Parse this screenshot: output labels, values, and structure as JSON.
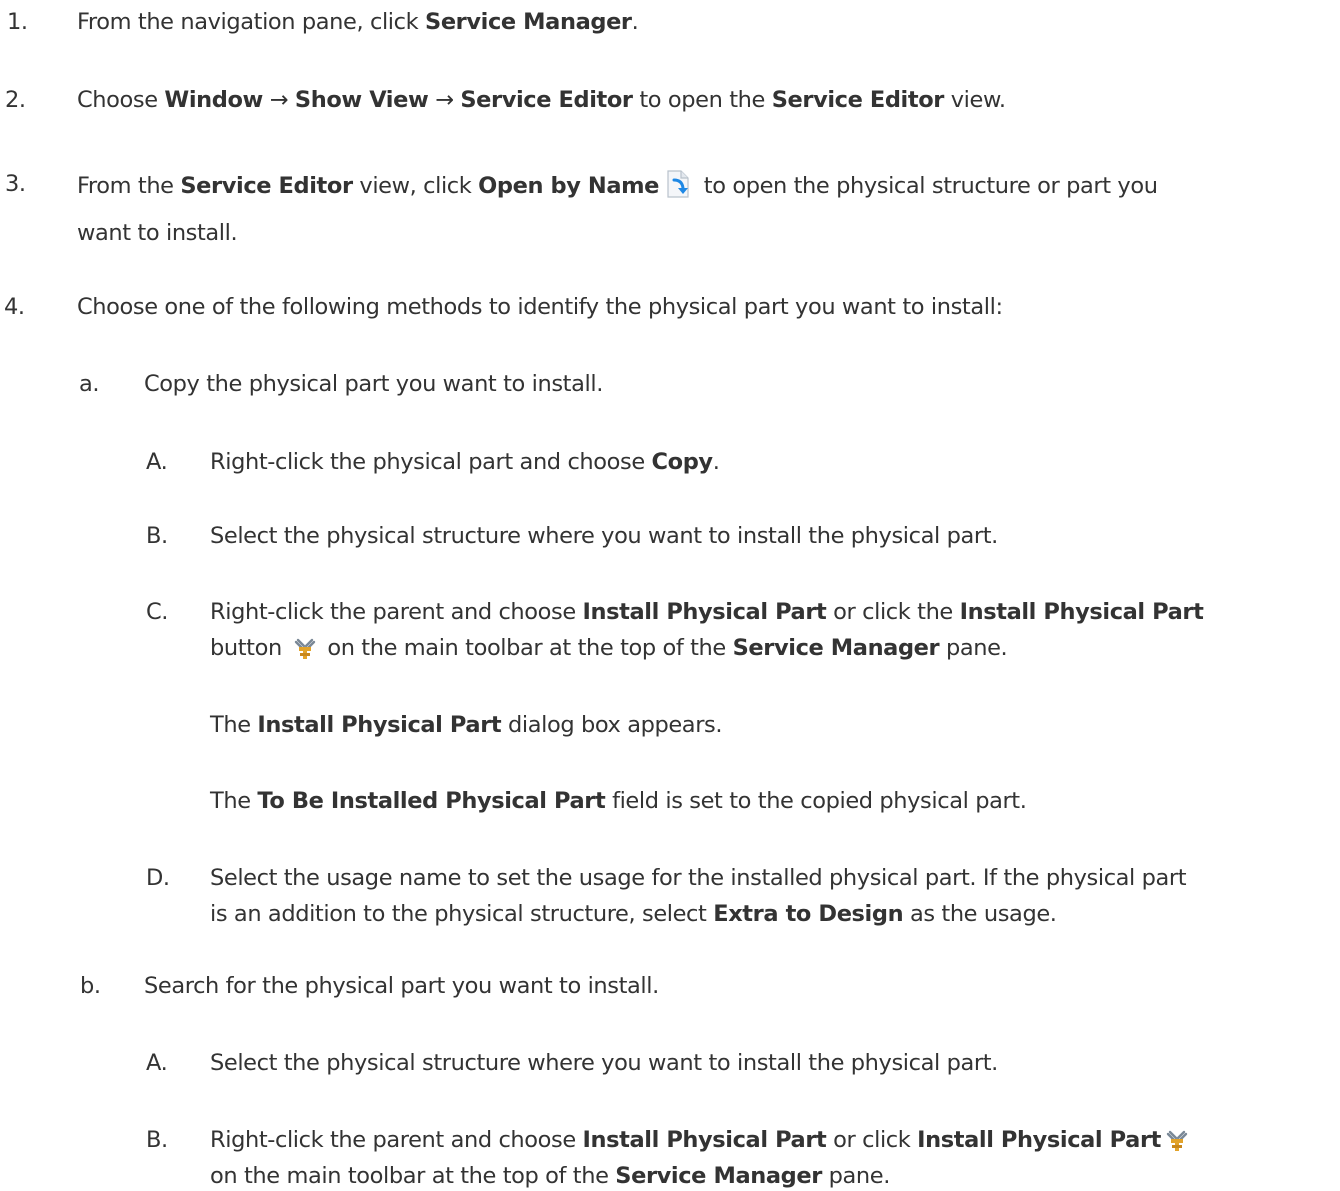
{
  "steps": [
    {
      "num": "1.",
      "parts": [
        "From the navigation pane, click ",
        "Service Manager",
        "."
      ]
    },
    {
      "num": "2.",
      "parts": [
        "Choose ",
        "Window",
        " → ",
        "Show View",
        " → ",
        "Service Editor",
        " to open the ",
        "Service Editor",
        " view."
      ]
    },
    {
      "num": "3.",
      "line1": [
        "From the ",
        "Service Editor",
        " view, click ",
        "Open by Name",
        "",
        " to open the physical structure or part you"
      ],
      "line2": "want to install.",
      "icon": "open-document-icon"
    },
    {
      "num": "4.",
      "parts": [
        "Choose one of the following methods to identify the physical part you want to install:"
      ]
    }
  ],
  "method_a": {
    "num": "a.",
    "text": "Copy the physical part you want to install.",
    "substeps": [
      {
        "num": "A.",
        "parts": [
          "Right-click the physical part and choose ",
          "Copy",
          "."
        ]
      },
      {
        "num": "B.",
        "parts": [
          "Select the physical structure where you want to install the physical part."
        ]
      },
      {
        "num": "C.",
        "line1": [
          "Right-click the parent and choose ",
          "Install Physical Part",
          " or click the ",
          "Install Physical Part"
        ],
        "line2": [
          "button ",
          "",
          " on the main toolbar at the top of the ",
          "Service Manager",
          " pane."
        ],
        "icon": "install-physical-part-icon"
      },
      {
        "note": [
          "The ",
          "Install Physical Part",
          " dialog box appears."
        ]
      },
      {
        "note": [
          "The ",
          "To Be Installed Physical Part",
          " field is set to the copied physical part."
        ]
      },
      {
        "num": "D.",
        "line1": [
          "Select the usage name to set the usage for the installed physical part. If the physical part"
        ],
        "line2": [
          "is an addition to the physical structure, select ",
          "Extra to Design",
          " as the usage."
        ]
      }
    ]
  },
  "method_b": {
    "num": "b.",
    "text": "Search for the physical part you want to install.",
    "substeps": [
      {
        "num": "A.",
        "parts": [
          "Select the physical structure where you want to install the physical part."
        ]
      },
      {
        "num": "B.",
        "line1": [
          "Right-click the parent and choose ",
          "Install Physical Part",
          " or click ",
          "Install Physical Part"
        ],
        "line2": [
          "on the main toolbar at the top of the ",
          "Service Manager",
          " pane."
        ],
        "icon": "install-physical-part-icon"
      }
    ]
  },
  "colors": {
    "text": "#333333",
    "icon_blue": "#1e88e5",
    "icon_gold": "#e2a32a"
  }
}
